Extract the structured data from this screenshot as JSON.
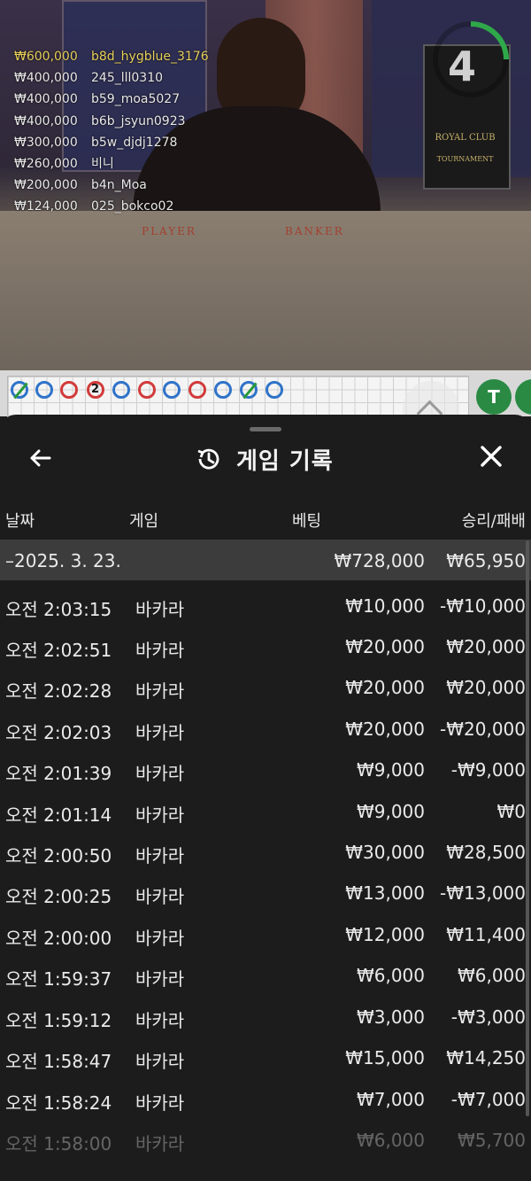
{
  "stream": {
    "countdown": "4",
    "table_labels": {
      "player": "PLAYER",
      "banker": "BANKER"
    },
    "sign": "ROYAL CLUB",
    "sign_sub": "TOURNAMENT"
  },
  "bet_feed": [
    {
      "amount": "₩600,000",
      "user": "b8d_hygblue_3176"
    },
    {
      "amount": "₩400,000",
      "user": "245_lll0310"
    },
    {
      "amount": "₩400,000",
      "user": "b59_moa5027"
    },
    {
      "amount": "₩400,000",
      "user": "b6b_jsyun0923"
    },
    {
      "amount": "₩300,000",
      "user": "b5w_djdj1278"
    },
    {
      "amount": "₩260,000",
      "user": "비니"
    },
    {
      "amount": "₩200,000",
      "user": "b4n_Moa"
    },
    {
      "amount": "₩124,000",
      "user": "025_bokco02"
    }
  ],
  "roadmap": {
    "bead_number": "2",
    "tie_label": "T"
  },
  "sheet": {
    "title": "게임 기록",
    "headers": {
      "date": "날짜",
      "game": "게임",
      "bet": "베팅",
      "result": "승리/패배"
    },
    "day_summary": {
      "date": "–2025. 3. 23.",
      "bet": "₩728,000",
      "result": "₩65,950"
    },
    "rows": [
      {
        "time": "오전 2:03:15",
        "game": "바카라",
        "bet": "₩10,000",
        "result": "-₩10,000"
      },
      {
        "time": "오전 2:02:51",
        "game": "바카라",
        "bet": "₩20,000",
        "result": "₩20,000"
      },
      {
        "time": "오전 2:02:28",
        "game": "바카라",
        "bet": "₩20,000",
        "result": "₩20,000"
      },
      {
        "time": "오전 2:02:03",
        "game": "바카라",
        "bet": "₩20,000",
        "result": "-₩20,000"
      },
      {
        "time": "오전 2:01:39",
        "game": "바카라",
        "bet": "₩9,000",
        "result": "-₩9,000"
      },
      {
        "time": "오전 2:01:14",
        "game": "바카라",
        "bet": "₩9,000",
        "result": "₩0"
      },
      {
        "time": "오전 2:00:50",
        "game": "바카라",
        "bet": "₩30,000",
        "result": "₩28,500"
      },
      {
        "time": "오전 2:00:25",
        "game": "바카라",
        "bet": "₩13,000",
        "result": "-₩13,000"
      },
      {
        "time": "오전 2:00:00",
        "game": "바카라",
        "bet": "₩12,000",
        "result": "₩11,400"
      },
      {
        "time": "오전 1:59:37",
        "game": "바카라",
        "bet": "₩6,000",
        "result": "₩6,000"
      },
      {
        "time": "오전 1:59:12",
        "game": "바카라",
        "bet": "₩3,000",
        "result": "-₩3,000"
      },
      {
        "time": "오전 1:58:47",
        "game": "바카라",
        "bet": "₩15,000",
        "result": "₩14,250"
      },
      {
        "time": "오전 1:58:24",
        "game": "바카라",
        "bet": "₩7,000",
        "result": "-₩7,000"
      },
      {
        "time": "오전 1:58:00",
        "game": "바카라",
        "bet": "₩6,000",
        "result": "₩5,700"
      }
    ]
  }
}
